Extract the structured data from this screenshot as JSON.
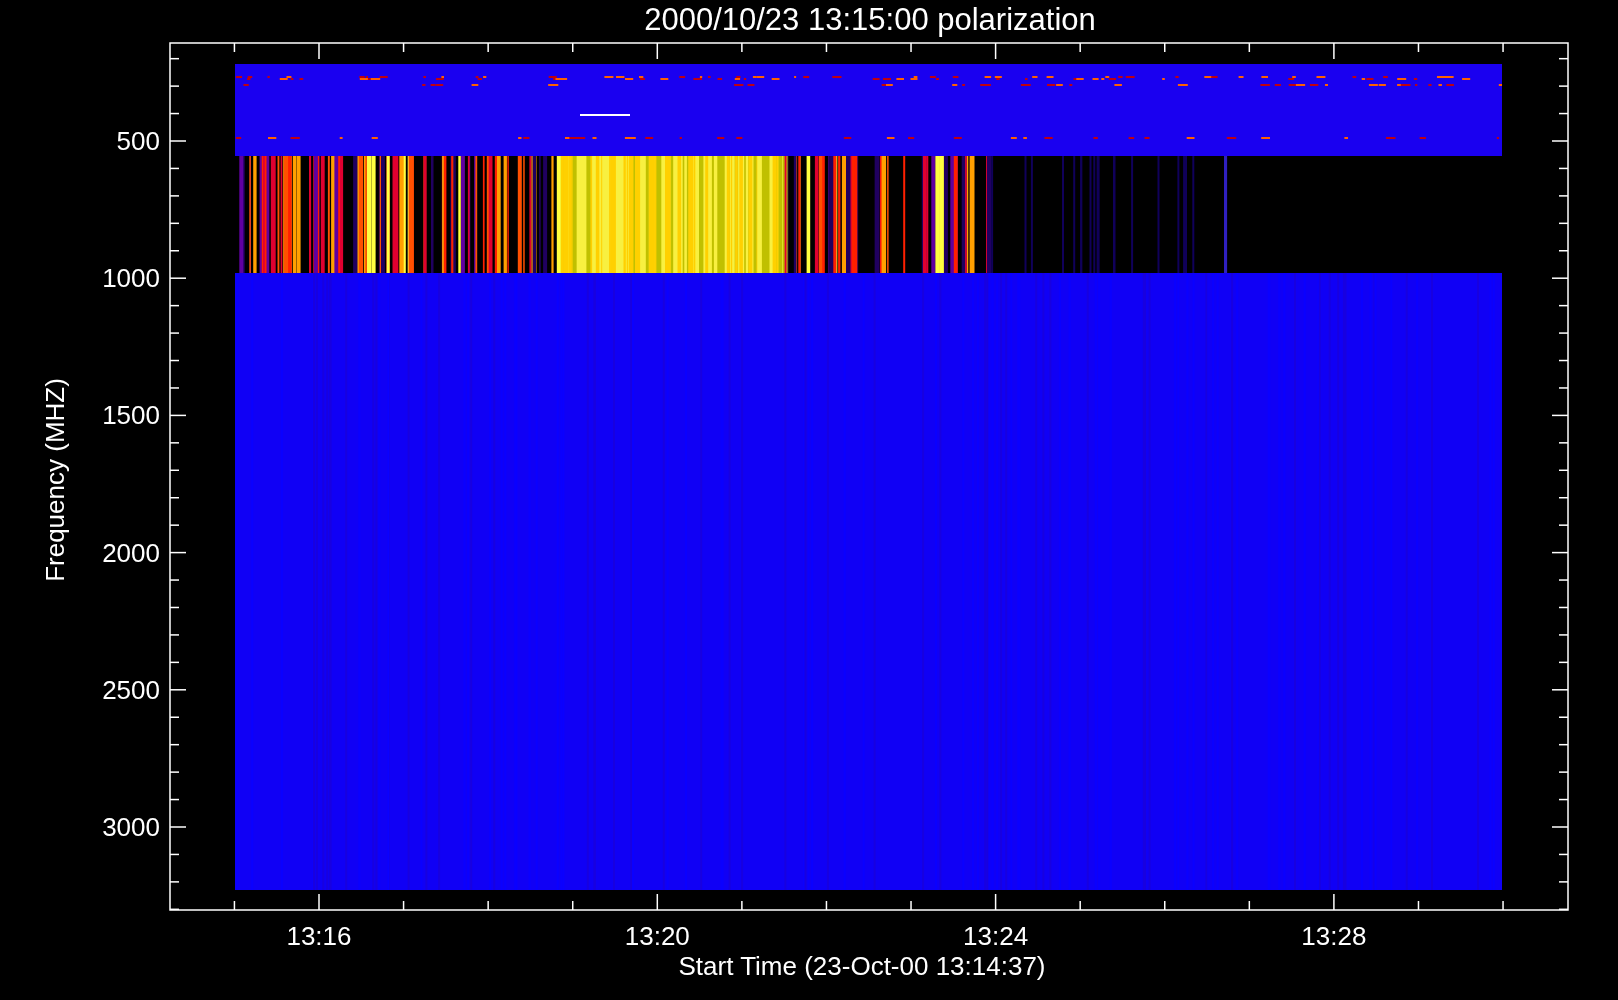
{
  "title": "2000/10/23 13:15:00 polarization",
  "x_axis": {
    "label": "Start Time (23-Oct-00 13:14:37)",
    "tick_labels": [
      "13:16",
      "13:20",
      "13:24",
      "13:28"
    ]
  },
  "y_axis": {
    "label": "Frequency (MHZ)",
    "tick_labels": [
      "500",
      "1000",
      "1500",
      "2000",
      "2500",
      "3000"
    ]
  }
}
